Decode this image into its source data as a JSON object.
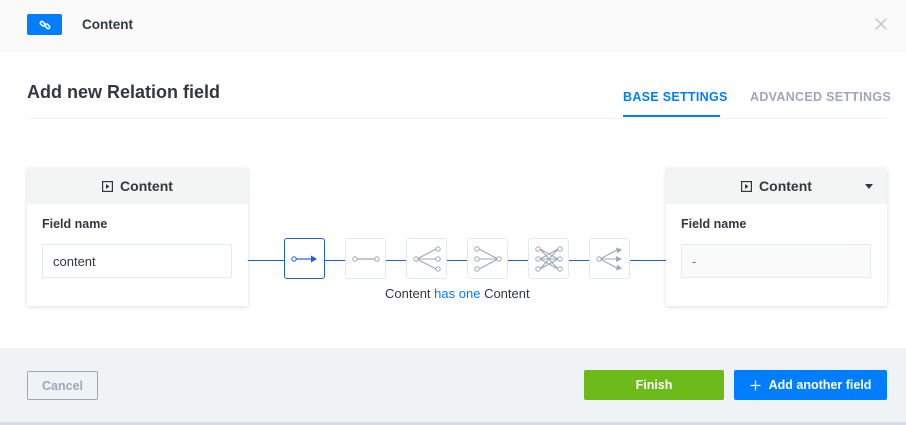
{
  "header": {
    "title": "Content",
    "badge_icon": "link-icon",
    "badge_color": "#007eff",
    "close_icon": "close-icon"
  },
  "modal": {
    "title": "Add new Relation field"
  },
  "tabs": [
    {
      "label": "BASE SETTINGS",
      "active": true
    },
    {
      "label": "ADVANCED SETTINGS",
      "active": false
    }
  ],
  "left_card": {
    "content_type": "Content",
    "icon": "content-type-icon",
    "field_label": "Field name",
    "field_value": "content"
  },
  "right_card": {
    "content_type": "Content",
    "icon": "content-type-icon",
    "field_label": "Field name",
    "field_placeholder": "-"
  },
  "relations": [
    {
      "name": "has-one",
      "active": true
    },
    {
      "name": "one-to-one",
      "active": false
    },
    {
      "name": "one-to-many",
      "active": false
    },
    {
      "name": "many-to-one",
      "active": false
    },
    {
      "name": "many-to-many",
      "active": false
    },
    {
      "name": "has-many",
      "active": false
    }
  ],
  "relation_text": {
    "left": "Content",
    "middle": "has one",
    "right": "Content"
  },
  "footer": {
    "cancel_label": "Cancel",
    "finish_label": "Finish",
    "add_label": "Add another field"
  },
  "colors": {
    "primary": "#007eff",
    "success": "#6dbb1a",
    "connector": "#1c5de7"
  }
}
